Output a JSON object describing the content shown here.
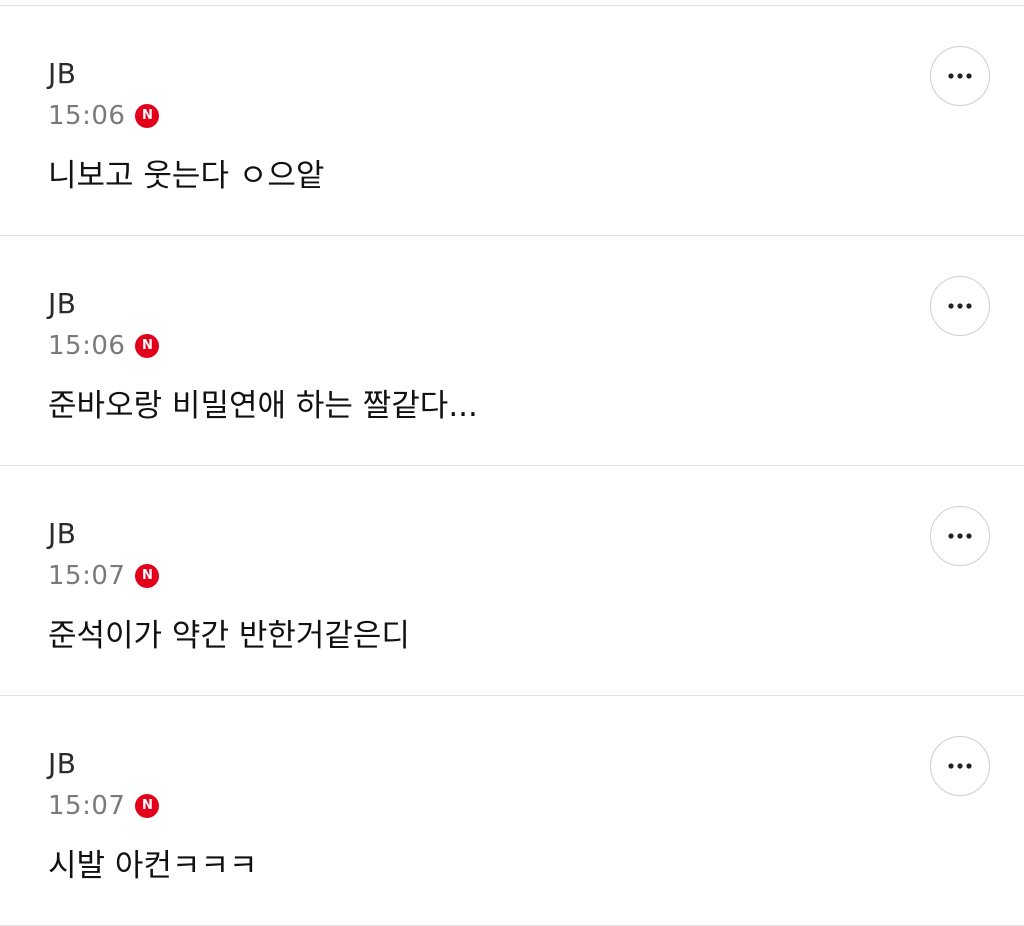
{
  "comments": [
    {
      "author": "JB",
      "time": "15:06",
      "badge": "N",
      "text": "니보고 웃는다 ㅇ으앝"
    },
    {
      "author": "JB",
      "time": "15:06",
      "badge": "N",
      "text": "준바오랑 비밀연애 하는 짤같다..."
    },
    {
      "author": "JB",
      "time": "15:07",
      "badge": "N",
      "text": "준석이가 약간 반한거같은디"
    },
    {
      "author": "JB",
      "time": "15:07",
      "badge": "N",
      "text": "시발 아컨ㅋㅋㅋ"
    }
  ],
  "colors": {
    "badge": "#e3001b",
    "divider": "#e2e2e2",
    "time": "#7a7a7a"
  },
  "icons": {
    "more": "more-horizontal-icon",
    "badge": "new-badge-icon"
  }
}
